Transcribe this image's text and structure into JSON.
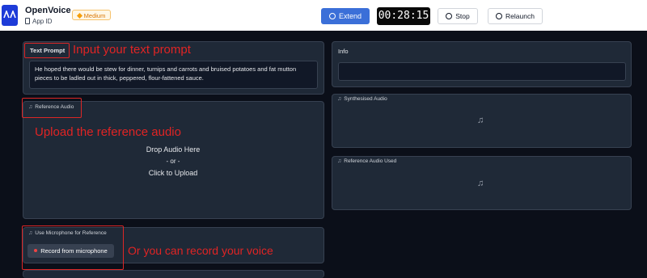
{
  "header": {
    "app_name": "OpenVoice",
    "app_id_label": "App ID",
    "tier_badge": "Medium",
    "extend_label": "Extend",
    "timer": "00:28:15",
    "stop_label": "Stop",
    "relaunch_label": "Relaunch"
  },
  "left": {
    "text_prompt_label": "Text Prompt",
    "text_prompt_value": "He hoped there would be stew for dinner, turnips and carrots and bruised potatoes and fat mutton pieces to be ladled out in thick, peppered, flour-fattened sauce.",
    "reference_audio_label": "Reference Audio",
    "drop_here": "Drop Audio Here",
    "or": "- or -",
    "click_upload": "Click to Upload",
    "mic_label": "Use Microphone for Reference",
    "record_label": "Record from microphone"
  },
  "right": {
    "info_label": "Info",
    "synth_label": "Synthesised Audio",
    "ref_used_label": "Reference Audio Used"
  },
  "annotations": {
    "a1": "Input your text prompt",
    "a2": "Upload the reference audio",
    "a3": "Or you can record your voice"
  },
  "icons": [
    "logo-icon",
    "phone-icon",
    "gem-icon",
    "extend-icon",
    "stop-icon",
    "relaunch-icon",
    "music-note-icon",
    "record-dot-icon"
  ],
  "colors": {
    "accent": "#3b6fd8",
    "annotation": "#e02424",
    "panel": "#1f2937",
    "background": "#0b0f19"
  }
}
